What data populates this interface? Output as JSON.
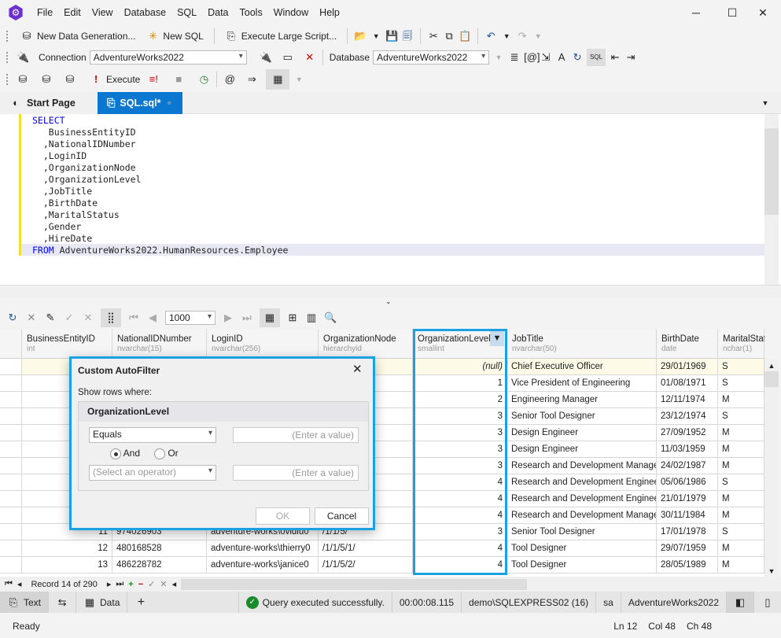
{
  "menu": [
    "File",
    "Edit",
    "View",
    "Database",
    "SQL",
    "Data",
    "Tools",
    "Window",
    "Help"
  ],
  "toolbar1": {
    "new_data_generation": "New Data Generation...",
    "new_sql": "New SQL",
    "execute_large_script": "Execute Large Script..."
  },
  "toolbar2": {
    "connection_label": "Connection",
    "connection_value": "AdventureWorks2022",
    "database_label": "Database",
    "database_value": "AdventureWorks2022"
  },
  "toolbar3": {
    "execute": "Execute"
  },
  "tabs": [
    {
      "label": "Start Page"
    },
    {
      "label": "SQL.sql*"
    }
  ],
  "accent": "#1ba1e2",
  "editor": {
    "lines": [
      "SELECT",
      "   BusinessEntityID",
      "  ,NationalIDNumber",
      "  ,LoginID",
      "  ,OrganizationNode",
      "  ,OrganizationLevel",
      "  ,JobTitle",
      "  ,BirthDate",
      "  ,MaritalStatus",
      "  ,Gender",
      "  ,HireDate",
      "FROM AdventureWorks2022.HumanResources.Employee"
    ]
  },
  "grid_toolbar": {
    "page_size": "1000"
  },
  "grid": {
    "columns": [
      {
        "name": "BusinessEntityID",
        "type": "int"
      },
      {
        "name": "NationalIDNumber",
        "type": "nvarchar(15)"
      },
      {
        "name": "LoginID",
        "type": "nvarchar(256)"
      },
      {
        "name": "OrganizationNode",
        "type": "hierarchyid"
      },
      {
        "name": "OrganizationLevel",
        "type": "smallint"
      },
      {
        "name": "JobTitle",
        "type": "nvarchar(50)"
      },
      {
        "name": "BirthDate",
        "type": "date"
      },
      {
        "name": "MaritalStatus",
        "type": "nchar(1)"
      }
    ],
    "rows": [
      [
        "",
        "",
        "",
        "",
        "(null)",
        "Chief Executive Officer",
        "29/01/1969",
        "S"
      ],
      [
        "",
        "",
        "",
        "",
        "1",
        "Vice President of Engineering",
        "01/08/1971",
        "S"
      ],
      [
        "",
        "",
        "",
        "",
        "2",
        "Engineering Manager",
        "12/11/1974",
        "M"
      ],
      [
        "",
        "",
        "",
        "",
        "3",
        "Senior Tool Designer",
        "23/12/1974",
        "S"
      ],
      [
        "",
        "",
        "",
        "",
        "3",
        "Design Engineer",
        "27/09/1952",
        "M"
      ],
      [
        "",
        "",
        "",
        "",
        "3",
        "Design Engineer",
        "11/03/1959",
        "M"
      ],
      [
        "",
        "",
        "",
        "",
        "3",
        "Research and Development Manager",
        "24/02/1987",
        "M"
      ],
      [
        "",
        "",
        "",
        "",
        "4",
        "Research and Development Engineer",
        "05/06/1986",
        "S"
      ],
      [
        "",
        "",
        "",
        "",
        "4",
        "Research and Development Engineer",
        "21/01/1979",
        "M"
      ],
      [
        "",
        "",
        "",
        "",
        "4",
        "Research and Development Manager",
        "30/11/1984",
        "M"
      ],
      [
        "11",
        "974026903",
        "adventure-works\\ovidiu0",
        "/1/1/5/",
        "3",
        "Senior Tool Designer",
        "17/01/1978",
        "S"
      ],
      [
        "12",
        "480168528",
        "adventure-works\\thierry0",
        "/1/1/5/1/",
        "4",
        "Tool Designer",
        "29/07/1959",
        "M"
      ],
      [
        "13",
        "486228782",
        "adventure-works\\janice0",
        "/1/1/5/2/",
        "4",
        "Tool Designer",
        "28/05/1989",
        "M"
      ]
    ]
  },
  "dialog": {
    "title": "Custom AutoFilter",
    "subtitle": "Show rows where:",
    "field": "OrganizationLevel",
    "operator1": "Equals",
    "value_placeholder": "(Enter a value)",
    "and": "And",
    "or": "Or",
    "operator2_placeholder": "(Select an operator)",
    "ok": "OK",
    "cancel": "Cancel"
  },
  "navigator": {
    "record": "Record 14 of 290"
  },
  "bottombar": {
    "text_tab": "Text",
    "data_tab": "Data",
    "message": "Query executed successfully.",
    "elapsed": "00:00:08.115",
    "server": "demo\\SQLEXPRESS02 (16)",
    "user": "sa",
    "database": "AdventureWorks2022"
  },
  "status": {
    "state": "Ready",
    "ln": "Ln 12",
    "col": "Col 48",
    "ch": "Ch 48"
  }
}
